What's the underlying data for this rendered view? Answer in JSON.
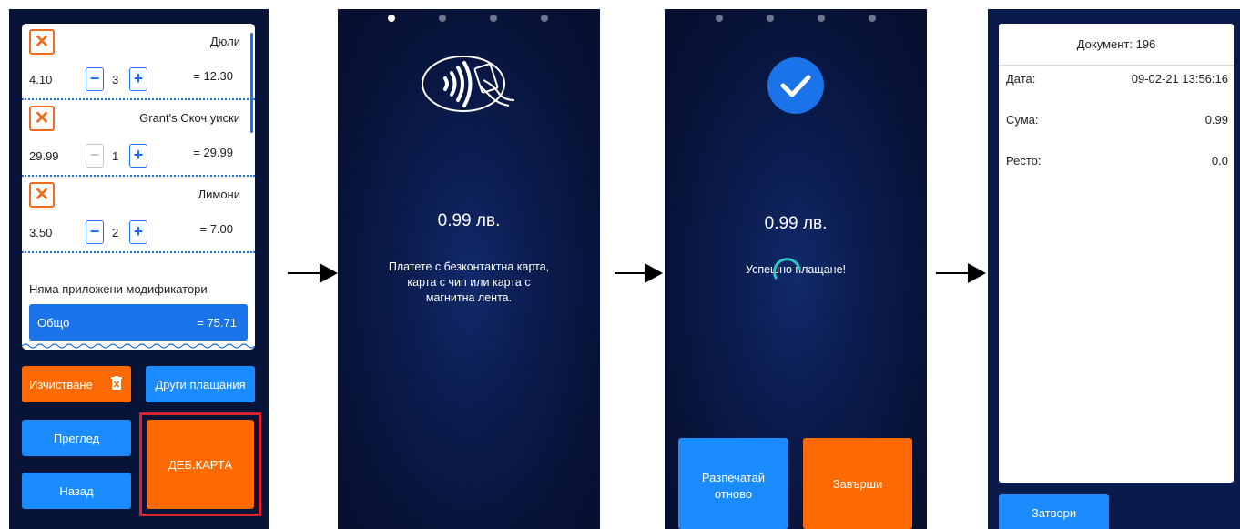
{
  "screen1": {
    "items": [
      {
        "name": "Дюли",
        "price": "4.10",
        "qty": "3",
        "total": "= 12.30",
        "minus_disabled": false
      },
      {
        "name": "Grant's Скоч уиски",
        "price": "29.99",
        "qty": "1",
        "total": "= 29.99",
        "minus_disabled": true
      },
      {
        "name": "Лимони",
        "price": "3.50",
        "qty": "2",
        "total": "= 7.00",
        "minus_disabled": false
      }
    ],
    "no_modifiers": "Няма приложени модификатори",
    "total_label": "Общо",
    "total_value": "= 75.71",
    "clear_button": "Изчистване",
    "other_payments_button": "Други плащания",
    "preview_button": "Преглед",
    "back_button": "Назад",
    "debit_card_button": "ДЕБ.КАРТА",
    "highlight_color": "#d9232e"
  },
  "screen2": {
    "amount": "0.99 лв.",
    "message": "Платете с безконтактна карта,\nкарта с чип или карта с\nмагнитна лента.",
    "page_indicator_active": 0
  },
  "screen3": {
    "amount": "0.99 лв.",
    "message": "Успешно плащане!",
    "print_again_button": "Разпечатай\nотново",
    "finish_button": "Завърши"
  },
  "screen4": {
    "document": "Документ: 196",
    "rows": [
      {
        "label": "Дата:",
        "value": "09-02-21 13:56:16"
      },
      {
        "label": "Сума:",
        "value": "0.99"
      },
      {
        "label": "Ресто:",
        "value": "0.0"
      }
    ],
    "close_button": "Затвори"
  },
  "colors": {
    "accent_blue": "#1a8cff",
    "accent_orange": "#ff6a00",
    "success_blue": "#1a73e8",
    "spinner": "#2ec4c4"
  },
  "icons": {
    "delete": "close-icon",
    "decrement": "minus-icon",
    "increment": "plus-icon",
    "trash": "trash-icon",
    "contactless": "contactless-payment-icon",
    "success": "checkmark-icon",
    "loading": "spinner-icon",
    "flow": "arrow-right-icon"
  }
}
